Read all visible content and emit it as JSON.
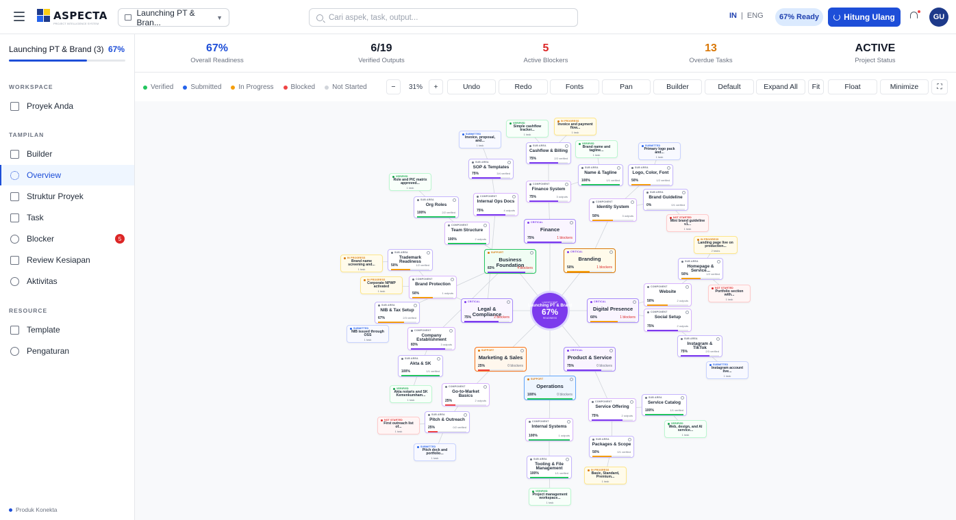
{
  "header": {
    "brand": "ASPECTA",
    "brand_sub": "PROJECT INTELLIGENCE SYSTEM",
    "project_select": "Launching PT & Bran...",
    "search_placeholder": "Cari aspek, task, output...",
    "lang_in": "IN",
    "lang_sep": "|",
    "lang_eng": "ENG",
    "ready_pill": "67% Ready",
    "hitung_button": "Hitung Ulang",
    "avatar": "GU"
  },
  "sidebar": {
    "project_title": "Launching PT & Brand (3)",
    "project_pct": "67%",
    "project_progress": 0.67,
    "section_workspace": "WORKSPACE",
    "section_tampilan": "TAMPILAN",
    "section_resource": "RESOURCE",
    "items": [
      {
        "label": "Proyek Anda",
        "icon": "calendar-icon"
      },
      {
        "label": "Builder",
        "icon": "list-icon"
      },
      {
        "label": "Overview",
        "icon": "overview-icon"
      },
      {
        "label": "Struktur Proyek",
        "icon": "activity-icon"
      },
      {
        "label": "Task",
        "icon": "grid-icon"
      },
      {
        "label": "Blocker",
        "icon": "block-icon",
        "badge": "5"
      },
      {
        "label": "Review Kesiapan",
        "icon": "check-square-icon"
      },
      {
        "label": "Aktivitas",
        "icon": "clock-icon"
      },
      {
        "label": "Template",
        "icon": "template-icon"
      },
      {
        "label": "Pengaturan",
        "icon": "gear-icon"
      }
    ],
    "footer": "Produk Konekta"
  },
  "stats": [
    {
      "value": "67%",
      "label": "Overall Readiness",
      "color": "#1d4ed8"
    },
    {
      "value": "6/19",
      "label": "Verified Outputs",
      "color": "#111827"
    },
    {
      "value": "5",
      "label": "Active Blockers",
      "color": "#dc2626"
    },
    {
      "value": "13",
      "label": "Overdue Tasks",
      "color": "#d97706"
    },
    {
      "value": "ACTIVE",
      "label": "Project Status",
      "color": "#111827"
    }
  ],
  "legend": [
    {
      "label": "Verified",
      "color": "#22c55e"
    },
    {
      "label": "Submitted",
      "color": "#2563eb"
    },
    {
      "label": "In Progress",
      "color": "#f59e0b"
    },
    {
      "label": "Blocked",
      "color": "#ef4444"
    },
    {
      "label": "Not Started",
      "color": "#d1d5db"
    }
  ],
  "toolbar": {
    "zoom_out": "−",
    "zoom_level": "31%",
    "zoom_in": "+",
    "undo": "Undo",
    "redo": "Redo",
    "fonts": "Fonts",
    "pan": "Pan",
    "builder": "Builder",
    "default": "Default",
    "expand_all": "Expand All",
    "fit": "Fit",
    "float": "Float",
    "minimize": "Minimize"
  },
  "center_node": {
    "kicker": "LAUNCH MAP",
    "title": "Launching PT & Brand",
    "pct": "67%",
    "sub": "READINESS"
  },
  "nodes": [
    {
      "title": "Business Foundation",
      "kind": "SUPPORT",
      "pct": "83%",
      "stat": "4 blockers"
    },
    {
      "title": "Finance",
      "kind": "CRITICAL",
      "pct": "75%",
      "stat": "1 blockers"
    },
    {
      "title": "Branding",
      "kind": "CRITICAL",
      "pct": "50%",
      "stat": "1 blockers"
    },
    {
      "title": "Legal & Compliance",
      "kind": "CRITICAL",
      "pct": "75%",
      "stat": "2 blockers"
    },
    {
      "title": "Digital Presence",
      "kind": "CRITICAL",
      "pct": "60%",
      "stat": "1 blockers"
    },
    {
      "title": "Marketing & Sales",
      "kind": "SUPPORT",
      "pct": "25%",
      "stat": "0 blockers"
    },
    {
      "title": "Product & Service",
      "kind": "CRITICAL",
      "pct": "75%",
      "stat": "0 blockers"
    },
    {
      "title": "Operations",
      "kind": "SUPPORT",
      "pct": "100%",
      "stat": "0 blockers"
    },
    {
      "title": "Simple cashflow tracker...",
      "kind": "VERIFIED",
      "pct": "",
      "stat": "1 task"
    },
    {
      "title": "Invoice and payment flow...",
      "kind": "IN PROGRESS",
      "pct": "",
      "stat": "1 task"
    },
    {
      "title": "Invoice, proposal, and...",
      "kind": "SUBMITTED",
      "pct": "",
      "stat": "1 task"
    },
    {
      "title": "Cashflow & Billing",
      "kind": "SUB AREA",
      "pct": "75%",
      "stat": "2/2 verified"
    },
    {
      "title": "Brand name and tagline...",
      "kind": "VERIFIED",
      "pct": "",
      "stat": "1 task"
    },
    {
      "title": "Primary logo pack and...",
      "kind": "SUBMITTED",
      "pct": "",
      "stat": "1 task"
    },
    {
      "title": "SOP & Templates",
      "kind": "SUB AREA",
      "pct": "75%",
      "stat": "3/4 verified"
    },
    {
      "title": "Name & Tagline",
      "kind": "SUB AREA",
      "pct": "100%",
      "stat": "1/1 verified"
    },
    {
      "title": "Logo, Color, Font",
      "kind": "SUB AREA",
      "pct": "50%",
      "stat": "1/2 verified"
    },
    {
      "title": "Role and PIC matrix approved...",
      "kind": "VERIFIED",
      "pct": "",
      "stat": "1 task"
    },
    {
      "title": "Finance System",
      "kind": "COMPONENT",
      "pct": "75%",
      "stat": "3 outputs"
    },
    {
      "title": "Brand Guideline",
      "kind": "SUB AREA",
      "pct": "0%",
      "stat": "0/1 verified"
    },
    {
      "title": "Org Roles",
      "kind": "SUB AREA",
      "pct": "100%",
      "stat": "2/2 verified"
    },
    {
      "title": "Internal Ops Docs",
      "kind": "COMPONENT",
      "pct": "75%",
      "stat": "4 outputs"
    },
    {
      "title": "Identity System",
      "kind": "COMPONENT",
      "pct": "50%",
      "stat": "3 outputs"
    },
    {
      "title": "Mini brand guideline v1...",
      "kind": "NOT STARTED",
      "pct": "",
      "stat": "1 task"
    },
    {
      "title": "Team Structure",
      "kind": "COMPONENT",
      "pct": "100%",
      "stat": "2 outputs"
    },
    {
      "title": "Landing page live on production...",
      "kind": "IN PROGRESS",
      "pct": "",
      "stat": "2 tasks"
    },
    {
      "title": "Trademark Readiness",
      "kind": "SUB AREA",
      "pct": "50%",
      "stat": "1/2 verified"
    },
    {
      "title": "Brand name screening and...",
      "kind": "IN PROGRESS",
      "pct": "",
      "stat": "1 task"
    },
    {
      "title": "Homepage & Service...",
      "kind": "SUB AREA",
      "pct": "50%",
      "stat": "1/2 verified"
    },
    {
      "title": "Corporate NPWP activated",
      "kind": "IN PROGRESS",
      "pct": "",
      "stat": "1 task"
    },
    {
      "title": "Brand Protection",
      "kind": "COMPONENT",
      "pct": "50%",
      "stat": "1 outputs"
    },
    {
      "title": "Portfolio section with...",
      "kind": "NOT STARTED",
      "pct": "",
      "stat": "1 task"
    },
    {
      "title": "Website",
      "kind": "COMPONENT",
      "pct": "50%",
      "stat": "2 outputs"
    },
    {
      "title": "NIB & Tax Setup",
      "kind": "SUB AREA",
      "pct": "67%",
      "stat": "2/3 verified"
    },
    {
      "title": "Social Setup",
      "kind": "COMPONENT",
      "pct": "75%",
      "stat": "2 outputs"
    },
    {
      "title": "NIB issued through OSS",
      "kind": "SUBMITTED",
      "pct": "",
      "stat": "1 task"
    },
    {
      "title": "Company Establishment",
      "kind": "COMPONENT",
      "pct": "83%",
      "stat": "3 outputs"
    },
    {
      "title": "Instagram & TikTok",
      "kind": "SUB AREA",
      "pct": "75%",
      "stat": "2/3 verified"
    },
    {
      "title": "Akta & SK",
      "kind": "SUB AREA",
      "pct": "100%",
      "stat": "1/1 verified"
    },
    {
      "title": "Instagram account live...",
      "kind": "SUBMITTED",
      "pct": "",
      "stat": "1 task"
    },
    {
      "title": "Akta notaris and SK Kemenkumham...",
      "kind": "VERIFIED",
      "pct": "",
      "stat": "1 task"
    },
    {
      "title": "Go-to-Market Basics",
      "kind": "COMPONENT",
      "pct": "25%",
      "stat": "2 outputs"
    },
    {
      "title": "Service Catalog",
      "kind": "SUB AREA",
      "pct": "100%",
      "stat": "1/1 verified"
    },
    {
      "title": "Service Offering",
      "kind": "COMPONENT",
      "pct": "75%",
      "stat": "2 outputs"
    },
    {
      "title": "Web, design, and AI service...",
      "kind": "VERIFIED",
      "pct": "",
      "stat": "1 task"
    },
    {
      "title": "First outreach list of...",
      "kind": "NOT STARTED",
      "pct": "",
      "stat": "1 task"
    },
    {
      "title": "Pitch & Outreach",
      "kind": "SUB AREA",
      "pct": "25%",
      "stat": "0/2 verified"
    },
    {
      "title": "Internal Systems",
      "kind": "COMPONENT",
      "pct": "100%",
      "stat": "1 outputs"
    },
    {
      "title": "Packages & Scope",
      "kind": "SUB AREA",
      "pct": "50%",
      "stat": "0/1 verified"
    },
    {
      "title": "Pitch deck and portfolio...",
      "kind": "SUBMITTED",
      "pct": "",
      "stat": "1 task"
    },
    {
      "title": "Tooling & File Management",
      "kind": "SUB AREA",
      "pct": "100%",
      "stat": "1/1 verified"
    },
    {
      "title": "Basic, Standard, Premium...",
      "kind": "IN PROGRESS",
      "pct": "",
      "stat": "1 task"
    },
    {
      "title": "Project management workspace...",
      "kind": "VERIFIED",
      "pct": "",
      "stat": "1 task"
    }
  ]
}
